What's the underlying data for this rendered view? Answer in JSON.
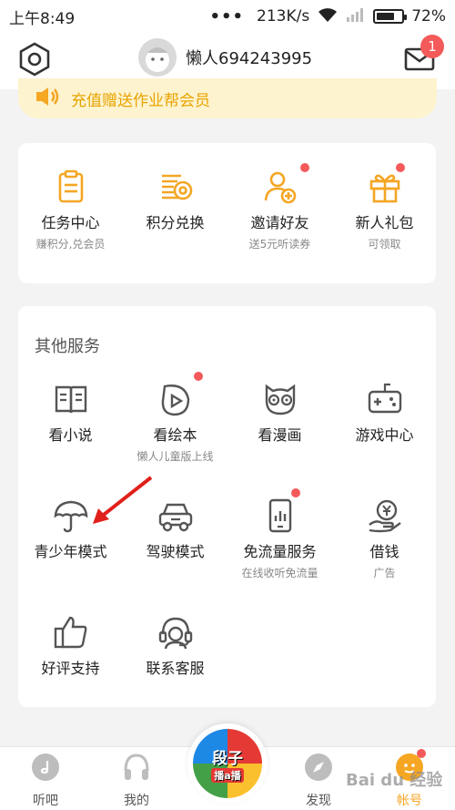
{
  "status_bar": {
    "time": "上午8:49",
    "net_speed": "213K/s",
    "battery": "72%",
    "battery_level": 0.72
  },
  "header": {
    "username": "懒人694243995",
    "message_count": "1"
  },
  "banner": {
    "text": "充值赠送作业帮会员"
  },
  "quick_actions": [
    {
      "label": "任务中心",
      "sub": "赚积分,兑会员",
      "icon": "clipboard-icon"
    },
    {
      "label": "积分兑换",
      "sub": "",
      "icon": "coins-icon"
    },
    {
      "label": "邀请好友",
      "sub": "送5元听读券",
      "icon": "add-user-icon"
    },
    {
      "label": "新人礼包",
      "sub": "可领取",
      "icon": "gift-icon"
    }
  ],
  "other_services": {
    "title": "其他服务",
    "items": [
      {
        "label": "看小说",
        "sub": "",
        "icon": "book-icon"
      },
      {
        "label": "看绘本",
        "sub": "懒人儿童版上线",
        "icon": "picture-book-icon"
      },
      {
        "label": "看漫画",
        "sub": "",
        "icon": "owl-icon"
      },
      {
        "label": "游戏中心",
        "sub": "",
        "icon": "gamepad-icon"
      },
      {
        "label": "青少年模式",
        "sub": "",
        "icon": "umbrella-icon"
      },
      {
        "label": "驾驶模式",
        "sub": "",
        "icon": "car-icon"
      },
      {
        "label": "免流量服务",
        "sub": "在线收听免流量",
        "icon": "phone-data-icon"
      },
      {
        "label": "借钱",
        "sub": "广告",
        "icon": "yuan-hand-icon"
      },
      {
        "label": "好评支持",
        "sub": "",
        "icon": "thumbs-up-icon"
      },
      {
        "label": "联系客服",
        "sub": "",
        "icon": "headset-icon"
      }
    ]
  },
  "tabbar": {
    "items": [
      {
        "label": "听吧",
        "icon": "music-disc-icon"
      },
      {
        "label": "我的",
        "icon": "headphones-icon"
      },
      {
        "label": "发现",
        "icon": "compass-icon"
      },
      {
        "label": "帐号",
        "icon": "account-icon"
      }
    ],
    "center_logo_line1": "段子",
    "center_logo_line2": "播a播"
  },
  "watermark": "Bai du 经验",
  "colors": {
    "accent": "#f5a623",
    "badge": "#f45a5a",
    "banner_bg": "#fdf3cf",
    "banner_text": "#e8a400"
  }
}
